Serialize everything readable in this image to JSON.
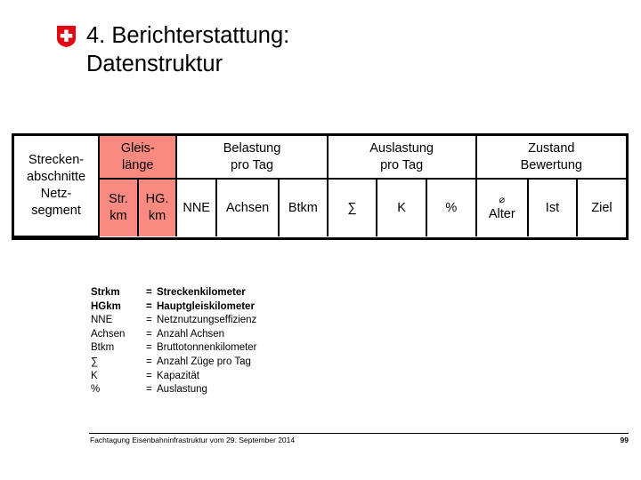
{
  "slide": {
    "title": "4. Berichterstattung:\nDatenstruktur",
    "logo_icon": "swiss-shield-icon",
    "logo_color": "#e30613"
  },
  "table": {
    "highlight_color": "#fa8a80",
    "group_headers": [
      {
        "label": "Strecken-\nabschnitte\nNetz-\nsegment",
        "span": 1
      },
      {
        "label": "Gleis-\nlänge",
        "span": 2
      },
      {
        "label": "Belastung\npro Tag",
        "span": 3
      },
      {
        "label": "Auslastung\npro Tag",
        "span": 3
      },
      {
        "label": "Zustand\nBewertung",
        "span": 3
      }
    ],
    "row_label": "Strecken-\nabschnitte\nNetz-\nsegment",
    "gleislaenge_label": "Gleis-\nlänge",
    "belastung_label": "Belastung\npro Tag",
    "auslastung_label": "Auslastung\npro Tag",
    "zustand_label": "Zustand\nBewertung",
    "sub_headers": {
      "strkm": "Str.\nkm",
      "hgkm": "HG.\nkm",
      "nne": "NNE",
      "achsen": "Achsen",
      "btkm": "Btkm",
      "summe": "∑",
      "kapazitaet": "K",
      "prozent": "%",
      "alter_symbol": "⌀",
      "alter_word": "Alter",
      "ist": "Ist",
      "ziel": "Ziel"
    }
  },
  "legend": {
    "rows": [
      {
        "key": "Strkm",
        "eq": "=",
        "value": "Streckenkilometer",
        "bold": true
      },
      {
        "key": "HGkm",
        "eq": "=",
        "value": "Hauptgleiskilometer",
        "bold": true
      },
      {
        "key": "NNE",
        "eq": "=",
        "value": "Netznutzungseffizienz",
        "bold": false
      },
      {
        "key": "Achsen",
        "eq": "=",
        "value": "Anzahl Achsen",
        "bold": false
      },
      {
        "key": "Btkm",
        "eq": "=",
        "value": "Bruttotonnenkilometer",
        "bold": false
      },
      {
        "key": "∑",
        "eq": "=",
        "value": "Anzahl Züge pro Tag",
        "bold": false
      },
      {
        "key": "K",
        "eq": "=",
        "value": "Kapazität",
        "bold": false
      },
      {
        "key": "%",
        "eq": "=",
        "value": "Auslastung",
        "bold": false
      }
    ]
  },
  "footer": {
    "text": "Fachtagung Eisenbahninfrastruktur vom 29. September 2014",
    "page": "99"
  }
}
